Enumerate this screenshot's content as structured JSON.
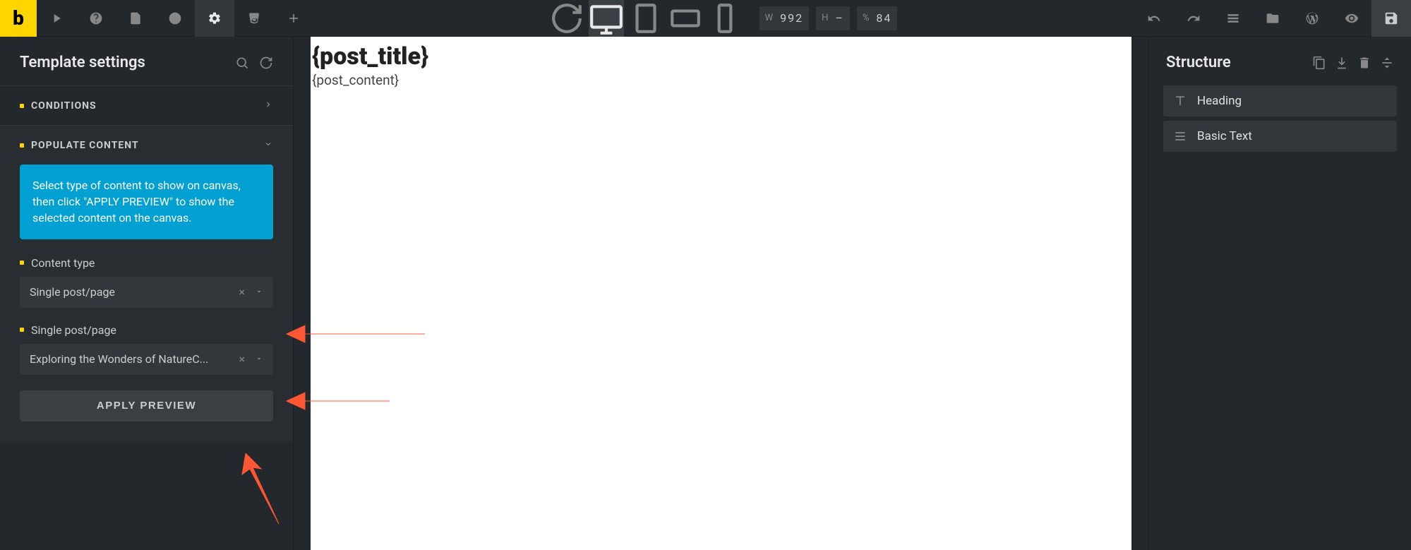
{
  "logo": "b",
  "dimensions": {
    "w_label": "W",
    "w_value": "992",
    "h_label": "H",
    "h_value": "–",
    "pct_label": "%",
    "pct_value": "84"
  },
  "leftPanel": {
    "title": "Template settings",
    "sections": {
      "conditions": {
        "label": "CONDITIONS"
      },
      "populate": {
        "label": "POPULATE CONTENT",
        "info": "Select type of content to show on canvas, then click \"APPLY PREVIEW\" to show the selected content on the canvas.",
        "content_type_label": "Content type",
        "content_type_value": "Single post/page",
        "single_label": "Single post/page",
        "single_value": "Exploring the Wonders of NatureC...",
        "apply": "APPLY PREVIEW"
      }
    }
  },
  "canvas": {
    "title": "{post_title}",
    "content": "{post_content}"
  },
  "rightPanel": {
    "title": "Structure",
    "items": [
      {
        "label": "Heading",
        "icon": "text"
      },
      {
        "label": "Basic Text",
        "icon": "lines"
      }
    ]
  }
}
